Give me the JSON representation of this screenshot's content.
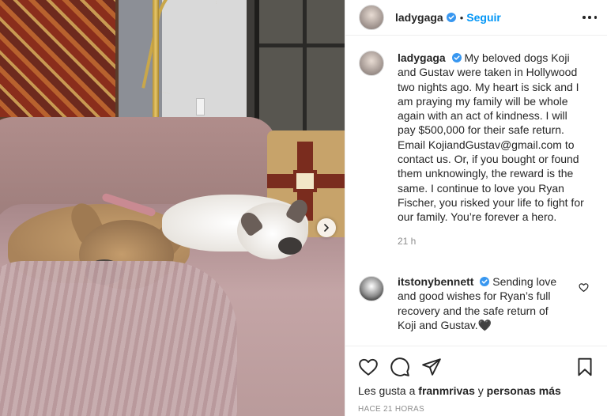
{
  "post": {
    "username": "ladygaga",
    "follow_label": "Seguir",
    "separator": "•",
    "caption": "My beloved dogs Koji and Gustav were taken in Hollywood two nights ago. My heart is sick and I am praying my family will be whole again with an act of kindness. I will pay $500,000 for their safe return. Email KojiandGustav@gmail.com to contact us. Or, if you bought or found them unknowingly, the reward is the same. I continue to love you Ryan Fischer, you risked your life to fight for our family. You’re forever a hero.",
    "caption_time": "21 h"
  },
  "comment": {
    "username": "itstonybennett",
    "text": "Sending love and good wishes for Ryan’s full recovery and the safe return of Koji and Gustav.🖤"
  },
  "likes": {
    "prefix": "Les gusta a",
    "user": "franmrivas",
    "connector": "y",
    "others": "personas más"
  },
  "posted_ago": "HACE 21 HORAS",
  "colors": {
    "accent": "#0095f6",
    "text": "#262626",
    "muted": "#8e8e8e",
    "border": "#efefef"
  },
  "icons": [
    "verified-icon",
    "more-options-icon",
    "heart-icon",
    "comment-icon",
    "share-icon",
    "bookmark-icon",
    "next-arrow-icon"
  ]
}
